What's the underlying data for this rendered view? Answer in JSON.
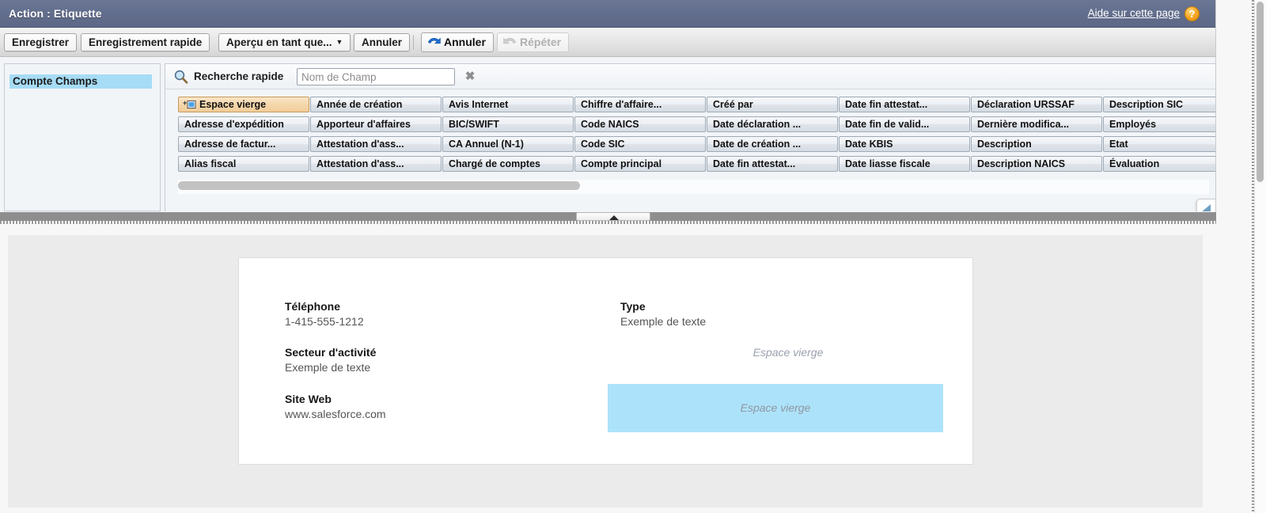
{
  "titlebar": {
    "title": "Action : Etiquette",
    "help_link": "Aide sur cette page",
    "help_icon_glyph": "?",
    "bg_color": "#626e8d"
  },
  "toolbar": {
    "save_label": "Enregistrer",
    "quick_save_label": "Enregistrement rapide",
    "preview_as_label": "Aperçu en tant que...",
    "preview_caret": "▼",
    "cancel_label": "Annuler",
    "undo_label": "Annuler",
    "redo_label": "Répéter",
    "undo_icon": "undo-arrow-icon",
    "redo_icon": "redo-arrow-icon",
    "undo_color": "#1f6fd0",
    "redo_color": "#c0c0c0"
  },
  "sidebar": {
    "items": [
      {
        "label": "Compte Champs",
        "selected": true,
        "highlight_color": "#a6dcf5"
      }
    ]
  },
  "palette": {
    "search_icon": "magnifier-icon",
    "search_label": "Recherche rapide",
    "search_value": "",
    "search_placeholder": "Nom de Champ",
    "clear_icon": "clear-x-icon",
    "columns": [
      {
        "tiles": [
          {
            "label": "Espace vierge",
            "selected": true,
            "icon": "blank-space-icon"
          },
          {
            "label": "Adresse d'expédition",
            "selected": false
          },
          {
            "label": "Adresse de factur...",
            "selected": false
          },
          {
            "label": "Alias fiscal",
            "selected": false
          }
        ]
      },
      {
        "tiles": [
          {
            "label": "Année de création",
            "selected": false
          },
          {
            "label": "Apporteur d'affaires",
            "selected": false
          },
          {
            "label": "Attestation d'ass...",
            "selected": false
          },
          {
            "label": "Attestation d'ass...",
            "selected": false
          }
        ]
      },
      {
        "tiles": [
          {
            "label": "Avis Internet",
            "selected": false
          },
          {
            "label": "BIC/SWIFT",
            "selected": false
          },
          {
            "label": "CA Annuel (N-1)",
            "selected": false
          },
          {
            "label": "Chargé de comptes",
            "selected": false
          }
        ]
      },
      {
        "tiles": [
          {
            "label": "Chiffre d'affaire...",
            "selected": false
          },
          {
            "label": "Code NAICS",
            "selected": false
          },
          {
            "label": "Code SIC",
            "selected": false
          },
          {
            "label": "Compte principal",
            "selected": false
          }
        ]
      },
      {
        "tiles": [
          {
            "label": "Créé par",
            "selected": false
          },
          {
            "label": "Date déclaration ...",
            "selected": false
          },
          {
            "label": "Date de création ...",
            "selected": false
          },
          {
            "label": "Date fin attestat...",
            "selected": false
          }
        ]
      },
      {
        "tiles": [
          {
            "label": "Date fin attestat...",
            "selected": false
          },
          {
            "label": "Date fin de valid...",
            "selected": false
          },
          {
            "label": "Date KBIS",
            "selected": false
          },
          {
            "label": "Date liasse fiscale",
            "selected": false
          }
        ]
      },
      {
        "tiles": [
          {
            "label": "Déclaration URSSAF",
            "selected": false
          },
          {
            "label": "Dernière modifica...",
            "selected": false
          },
          {
            "label": "Description",
            "selected": false
          },
          {
            "label": "Description NAICS",
            "selected": false
          }
        ]
      },
      {
        "tiles": [
          {
            "label": "Description SIC",
            "selected": false
          },
          {
            "label": "Employés",
            "selected": false
          },
          {
            "label": "Etat",
            "selected": false
          },
          {
            "label": "Évaluation",
            "selected": false
          }
        ]
      }
    ],
    "collapse_tab_icon": "chevron-left-icon"
  },
  "splitter": {
    "handle_icon": "collapse-triangle-icon"
  },
  "preview": {
    "left_column": [
      {
        "label": "Téléphone",
        "value": "1-415-555-1212"
      },
      {
        "label": "Secteur d'activité",
        "value": "Exemple de texte"
      },
      {
        "label": "Site Web",
        "value": "www.salesforce.com"
      }
    ],
    "right_column": [
      {
        "label": "Type",
        "value": "Exemple de texte"
      }
    ],
    "blank_slot_label": "Espace vierge",
    "blank_drop_label": "Espace vierge",
    "blank_drop_color": "#ade3fa"
  }
}
